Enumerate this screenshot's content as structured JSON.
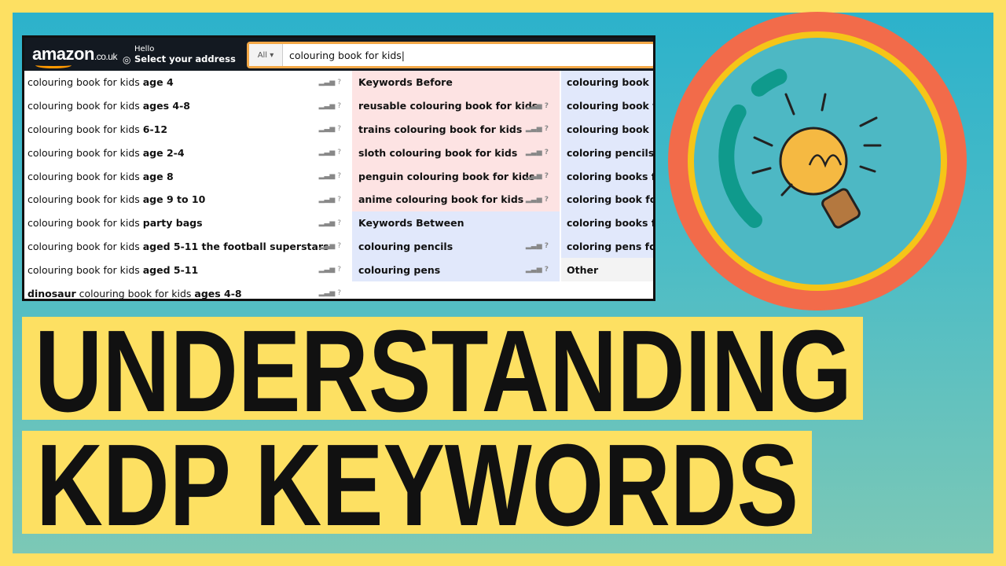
{
  "nav": {
    "logo": "amazon",
    "logo_suffix": ".co.uk",
    "hello": "Hello",
    "address": "Select your address",
    "category": "All",
    "query": "colouring book for kids"
  },
  "suggestions": [
    {
      "pre": "",
      "base": "colouring book for kids ",
      "bold": "age 4"
    },
    {
      "pre": "",
      "base": "colouring book for kids ",
      "bold": "ages 4-8"
    },
    {
      "pre": "",
      "base": "colouring book for kids ",
      "bold": "6-12"
    },
    {
      "pre": "",
      "base": "colouring book for kids ",
      "bold": "age 2-4"
    },
    {
      "pre": "",
      "base": "colouring book for kids ",
      "bold": "age 8"
    },
    {
      "pre": "",
      "base": "colouring book for kids ",
      "bold": "age 9 to 10"
    },
    {
      "pre": "",
      "base": "colouring book for kids ",
      "bold": "party bags"
    },
    {
      "pre": "",
      "base": "colouring book for kids ",
      "bold": "aged 5-11 the football superstars"
    },
    {
      "pre": "",
      "base": "colouring book for kids ",
      "bold": "aged 5-11"
    },
    {
      "pre": "dinosaur",
      "base": " colouring book for kids ",
      "bold": "ages 4-8"
    }
  ],
  "signal": "?",
  "keywords_before": {
    "title": "Keywords Before",
    "items": [
      "reusable colouring book for kids",
      "trains colouring book for kids",
      "sloth colouring book for kids",
      "penguin colouring book for kids",
      "anime colouring book for kids"
    ]
  },
  "keywords_between": {
    "title": "Keywords Between",
    "items": [
      "colouring pencils",
      "colouring pens"
    ]
  },
  "related": [
    "colouring book",
    "colouring book fo",
    "colouring book ki",
    "coloring pencils s",
    "coloring books fo",
    "coloring book for",
    "coloring books fo",
    "coloring pens for"
  ],
  "related_other": "Other",
  "headline": {
    "line1": "UNDERSTANDING",
    "line2": "KDP KEYWORDS"
  },
  "colors": {
    "frame": "#fde062",
    "ring": "#f26b4a",
    "handle": "#0f9a8c",
    "accent": "#f5c518"
  }
}
